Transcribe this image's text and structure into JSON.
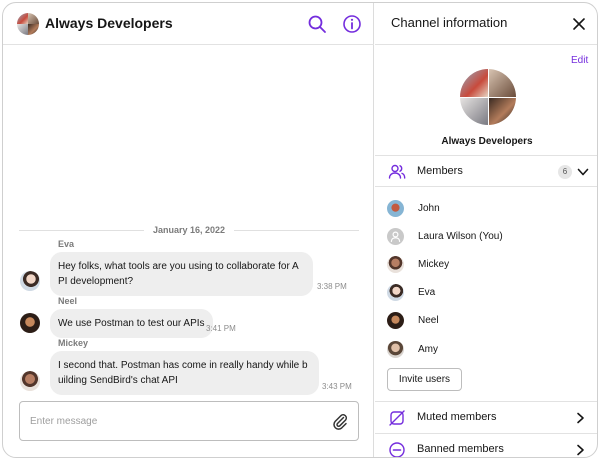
{
  "chat": {
    "title": "Always Developers",
    "date_separator": "January 16, 2022",
    "messages": [
      {
        "sender": "Eva",
        "text": "Hey folks, what tools are you using to collaborate for API development?",
        "time": "3:38 PM"
      },
      {
        "sender": "Neel",
        "text": "We use Postman to test our APIs",
        "time": "3:41 PM"
      },
      {
        "sender": "Mickey",
        "text": "I second that. Postman has come in really handy while building SendBird's chat API",
        "time": "3:43 PM"
      }
    ],
    "input_placeholder": "Enter message"
  },
  "info": {
    "title": "Channel information",
    "edit_label": "Edit",
    "channel_name": "Always Developers",
    "members_label": "Members",
    "members_count": "6",
    "members": [
      "John",
      "Laura Wilson (You)",
      "Mickey",
      "Eva",
      "Neel",
      "Amy"
    ],
    "invite_label": "Invite users",
    "muted_label": "Muted members",
    "banned_label": "Banned members"
  },
  "colors": {
    "accent": "#742ddd",
    "bubble": "#eeeeee",
    "border": "#e2e2e2"
  },
  "icons": {
    "search": "search-icon",
    "info": "info-icon",
    "close": "close-icon",
    "attach": "paperclip-icon",
    "members": "members-icon",
    "muted": "muted-icon",
    "banned": "banned-icon"
  }
}
